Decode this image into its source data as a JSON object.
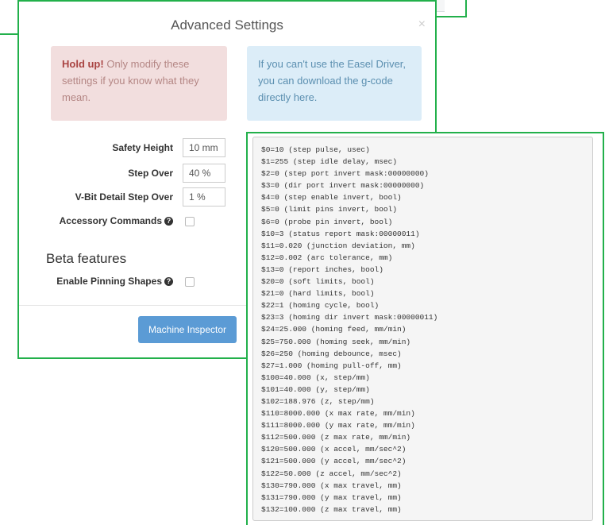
{
  "modal": {
    "title": "Advanced Settings",
    "close_label": "×",
    "warning": {
      "strong": "Hold up!",
      "text": " Only modify these settings if you know what they mean."
    },
    "info": {
      "text": "If you can't use the Easel Driver, you can download the g-code directly here."
    },
    "fields": [
      {
        "label": "Safety Height",
        "value": "10 mm"
      },
      {
        "label": "Step Over",
        "value": "40 %"
      },
      {
        "label": "V-Bit Detail Step Over",
        "value": "1 %"
      }
    ],
    "accessory": {
      "label": "Accessory Commands",
      "help_icon": "?",
      "checked": false
    },
    "beta": {
      "title": "Beta features",
      "pinning": {
        "label": "Enable Pinning Shapes",
        "help_icon": "?",
        "checked": false
      }
    },
    "machine_inspector_label": "Machine Inspector"
  },
  "gcode": {
    "lines": [
      "$0=10 (step pulse, usec)",
      "$1=255 (step idle delay, msec)",
      "$2=0 (step port invert mask:00000000)",
      "$3=0 (dir port invert mask:00000000)",
      "$4=0 (step enable invert, bool)",
      "$5=0 (limit pins invert, bool)",
      "$6=0 (probe pin invert, bool)",
      "$10=3 (status report mask:00000011)",
      "$11=0.020 (junction deviation, mm)",
      "$12=0.002 (arc tolerance, mm)",
      "$13=0 (report inches, bool)",
      "$20=0 (soft limits, bool)",
      "$21=0 (hard limits, bool)",
      "$22=1 (homing cycle, bool)",
      "$23=3 (homing dir invert mask:00000011)",
      "$24=25.000 (homing feed, mm/min)",
      "$25=750.000 (homing seek, mm/min)",
      "$26=250 (homing debounce, msec)",
      "$27=1.000 (homing pull-off, mm)",
      "$100=40.000 (x, step/mm)",
      "$101=40.000 (y, step/mm)",
      "$102=188.976 (z, step/mm)",
      "$110=8000.000 (x max rate, mm/min)",
      "$111=8000.000 (y max rate, mm/min)",
      "$112=500.000 (z max rate, mm/min)",
      "$120=500.000 (x accel, mm/sec^2)",
      "$121=500.000 (y accel, mm/sec^2)",
      "$122=50.000 (z accel, mm/sec^2)",
      "$130=790.000 (x max travel, mm)",
      "$131=790.000 (y max travel, mm)",
      "$132=100.000 (z max travel, mm)"
    ]
  }
}
